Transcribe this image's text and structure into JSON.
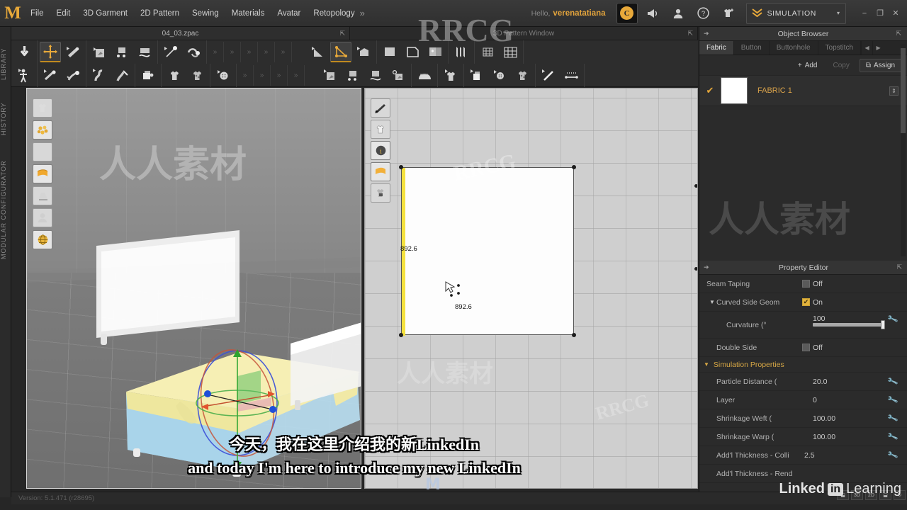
{
  "app": {
    "logo": "M",
    "version": "Version: 5.1.471 (r28695)"
  },
  "menubar": {
    "items": [
      {
        "label": "File"
      },
      {
        "label": "Edit"
      },
      {
        "label": "3D Garment"
      },
      {
        "label": "2D Pattern"
      },
      {
        "label": "Sewing"
      },
      {
        "label": "Materials"
      },
      {
        "label": "Avatar"
      },
      {
        "label": "Retopology"
      }
    ],
    "overflow": "»",
    "hello": "Hello,",
    "username": "verenatatiana",
    "mode": "SIMULATION",
    "mode_caret": "▾",
    "window": {
      "minimize": "−",
      "restore": "❐",
      "close": "✕"
    }
  },
  "rail": {
    "items": [
      {
        "label": "LIBRARY"
      },
      {
        "label": "HISTORY"
      },
      {
        "label": "MODULAR CONFIGURATOR"
      }
    ]
  },
  "tabs": [
    {
      "label": "04_03.zpac",
      "popout": "⇱"
    },
    {
      "label": "3D Pattern Window",
      "popout": "⇱"
    }
  ],
  "viewport2d": {
    "measure_left": "892.6",
    "measure_bottom": "892.6"
  },
  "object_browser": {
    "title": "Object Browser",
    "pin": "➜",
    "popout": "⇱",
    "tabs": [
      {
        "label": "Fabric",
        "active": true
      },
      {
        "label": "Button",
        "active": false
      },
      {
        "label": "Buttonhole",
        "active": false
      },
      {
        "label": "Topstitch",
        "active": false
      }
    ],
    "tab_prev": "◀",
    "tab_next": "▶",
    "actions": [
      {
        "label": "Add",
        "icon": "+",
        "enabled": true
      },
      {
        "label": "Copy",
        "icon": "",
        "enabled": false
      },
      {
        "label": "Assign",
        "icon": "⧉",
        "enabled": true
      }
    ],
    "fabric": {
      "checked": "✔",
      "name": "FABRIC 1",
      "swatch_color": "#ffffff",
      "row_icon": "⇕"
    }
  },
  "property_editor": {
    "title": "Property Editor",
    "pin": "➜",
    "popout": "⇱",
    "rows": [
      {
        "type": "check",
        "label": "Seam Taping",
        "value": "Off",
        "on": false
      },
      {
        "type": "check-group",
        "label": "Curved Side Geom",
        "value": "On",
        "on": true,
        "caret": "▼"
      },
      {
        "type": "slider",
        "label": "Curvature (°",
        "value": "100"
      },
      {
        "type": "check",
        "label": "Double Side",
        "value": "Off",
        "on": false
      },
      {
        "type": "group",
        "label": "Simulation Properties",
        "caret": "▼"
      },
      {
        "type": "field",
        "label": "Particle Distance (",
        "value": "20.0"
      },
      {
        "type": "field",
        "label": "Layer",
        "value": "0"
      },
      {
        "type": "field",
        "label": "Shrinkage Weft (",
        "value": "100.00"
      },
      {
        "type": "field",
        "label": "Shrinkage Warp (",
        "value": "100.00"
      },
      {
        "type": "field",
        "label": "Add'l Thickness - Colli",
        "value": "2.5"
      },
      {
        "type": "field",
        "label": "Add'l Thickness - Rend",
        "value": ""
      }
    ]
  },
  "subtitles": {
    "line1": "今天，我在这里介绍我的新LinkedIn",
    "line2": "and today I'm here to introduce my new LinkedIn"
  },
  "bottom_right": {
    "buttons": [
      {
        "label": "⬓"
      },
      {
        "label": "3D"
      },
      {
        "label": "2D"
      },
      {
        "label": "⬓"
      },
      {
        "label": "↻"
      }
    ]
  },
  "branding": {
    "linked": "Linked",
    "in": "in",
    "learning": "Learning"
  },
  "watermarks": {
    "rrcg": "RRCG",
    "people": "人人素材",
    "m_mark": "M"
  }
}
